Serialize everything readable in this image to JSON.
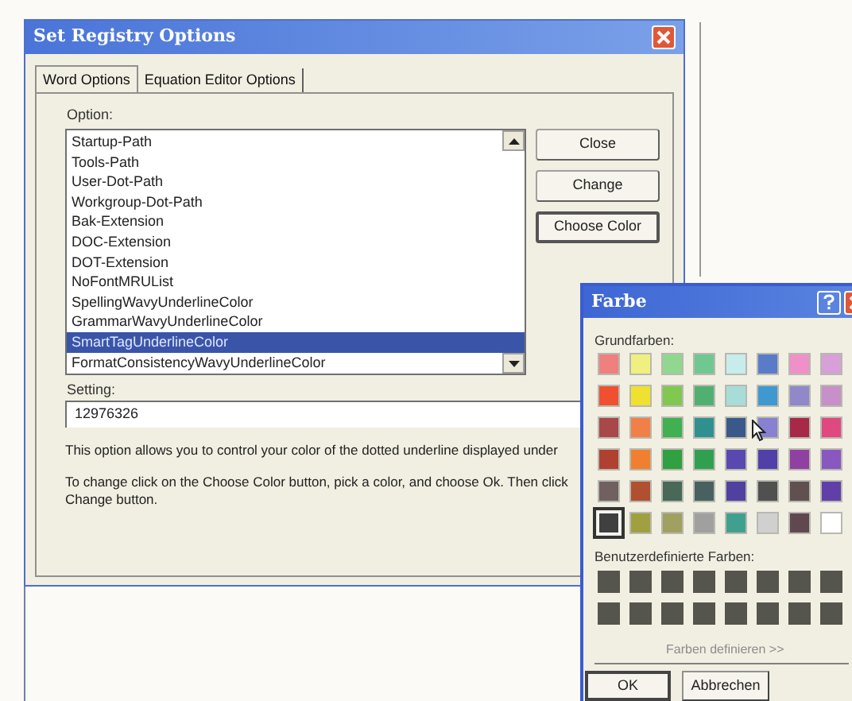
{
  "main_window": {
    "title": "Set Registry Options",
    "tabs": [
      {
        "label": "Word Options",
        "selected": true
      },
      {
        "label": "Equation Editor Options",
        "selected": false
      }
    ],
    "option_label": "Option:",
    "options": [
      {
        "label": "Startup-Path",
        "selected": false
      },
      {
        "label": "Tools-Path",
        "selected": false
      },
      {
        "label": "User-Dot-Path",
        "selected": false
      },
      {
        "label": "Workgroup-Dot-Path",
        "selected": false
      },
      {
        "label": "Bak-Extension",
        "selected": false
      },
      {
        "label": "DOC-Extension",
        "selected": false
      },
      {
        "label": "DOT-Extension",
        "selected": false
      },
      {
        "label": "NoFontMRUList",
        "selected": false
      },
      {
        "label": "SpellingWavyUnderlineColor",
        "selected": false
      },
      {
        "label": "GrammarWavyUnderlineColor",
        "selected": false
      },
      {
        "label": "SmartTagUnderlineColor",
        "selected": true
      },
      {
        "label": "FormatConsistencyWavyUnderlineColor",
        "selected": false
      }
    ],
    "buttons": [
      {
        "label": "Close",
        "focused": false
      },
      {
        "label": "Change",
        "focused": false
      },
      {
        "label": "Choose Color",
        "focused": true
      }
    ],
    "setting_label": "Setting:",
    "setting_value": "12976326",
    "description": "This option allows you to control your color of the dotted underline displayed under",
    "instructions": [
      "To change click on the Choose Color button, pick a color, and choose Ok.  Then click",
      "Change button."
    ]
  },
  "color_dialog": {
    "title": "Farbe",
    "basic_label": "Grundfarben:",
    "basic_colors": [
      {
        "color": "#f08080",
        "selected": false
      },
      {
        "color": "#f0f080",
        "selected": false
      },
      {
        "color": "#90d890",
        "selected": false
      },
      {
        "color": "#70c890",
        "selected": false
      },
      {
        "color": "#c8ecec",
        "selected": false
      },
      {
        "color": "#5a7cc8",
        "selected": false
      },
      {
        "color": "#f090c8",
        "selected": false
      },
      {
        "color": "#d8a0d8",
        "selected": false
      },
      {
        "color": "#f05030",
        "selected": false
      },
      {
        "color": "#f0e030",
        "selected": false
      },
      {
        "color": "#80c850",
        "selected": false
      },
      {
        "color": "#50b070",
        "selected": false
      },
      {
        "color": "#a8dcd8",
        "selected": false
      },
      {
        "color": "#4098d0",
        "selected": false
      },
      {
        "color": "#9088c8",
        "selected": false
      },
      {
        "color": "#c890c8",
        "selected": false
      },
      {
        "color": "#a84848",
        "selected": false
      },
      {
        "color": "#f08048",
        "selected": false
      },
      {
        "color": "#40b050",
        "selected": false
      },
      {
        "color": "#309090",
        "selected": false
      },
      {
        "color": "#3a5888",
        "selected": false
      },
      {
        "color": "#8880d0",
        "selected": false
      },
      {
        "color": "#a82848",
        "selected": false
      },
      {
        "color": "#e04880",
        "selected": false
      },
      {
        "color": "#b04030",
        "selected": false
      },
      {
        "color": "#f08030",
        "selected": false
      },
      {
        "color": "#30a040",
        "selected": false
      },
      {
        "color": "#30a050",
        "selected": false
      },
      {
        "color": "#5848b0",
        "selected": false
      },
      {
        "color": "#5040a8",
        "selected": false
      },
      {
        "color": "#9040a0",
        "selected": false
      },
      {
        "color": "#8858c0",
        "selected": false
      },
      {
        "color": "#706060",
        "selected": false
      },
      {
        "color": "#b05030",
        "selected": false
      },
      {
        "color": "#486858",
        "selected": false
      },
      {
        "color": "#486060",
        "selected": false
      },
      {
        "color": "#5040a0",
        "selected": false
      },
      {
        "color": "#505050",
        "selected": false
      },
      {
        "color": "#605050",
        "selected": false
      },
      {
        "color": "#6040a8",
        "selected": false
      },
      {
        "color": "#404040",
        "selected": true
      },
      {
        "color": "#a0a040",
        "selected": false
      },
      {
        "color": "#a0a060",
        "selected": false
      },
      {
        "color": "#a0a0a0",
        "selected": false
      },
      {
        "color": "#40a090",
        "selected": false
      },
      {
        "color": "#d0d0d0",
        "selected": false
      },
      {
        "color": "#604850",
        "selected": false
      },
      {
        "color": "#ffffff",
        "selected": false
      }
    ],
    "custom_label": "Benutzerdefinierte Farben:",
    "custom_colors": [
      {
        "color": "#55554d"
      },
      {
        "color": "#55554d"
      },
      {
        "color": "#55554d"
      },
      {
        "color": "#55554d"
      },
      {
        "color": "#55554d"
      },
      {
        "color": "#55554d"
      },
      {
        "color": "#55554d"
      },
      {
        "color": "#55554d"
      },
      {
        "color": "#55554d"
      },
      {
        "color": "#55554d"
      },
      {
        "color": "#55554d"
      },
      {
        "color": "#55554d"
      },
      {
        "color": "#55554d"
      },
      {
        "color": "#55554d"
      },
      {
        "color": "#55554d"
      },
      {
        "color": "#55554d"
      }
    ],
    "define_button": {
      "label": "Farben definieren >>",
      "disabled": true
    },
    "buttons": [
      {
        "label": "OK",
        "focused": true
      },
      {
        "label": "Abbrechen",
        "focused": false
      }
    ]
  }
}
